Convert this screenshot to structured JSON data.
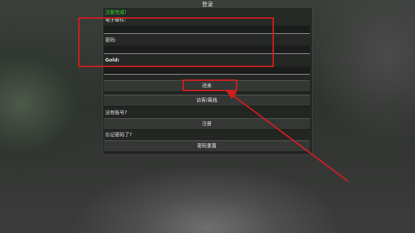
{
  "header": {
    "title": "登录"
  },
  "form": {
    "success_message": "注册完成!",
    "email_label": "电子邮件:",
    "email_value": "",
    "password_label": "密码:",
    "password_value": "",
    "gold_label": "Gold:",
    "gold_value": ""
  },
  "buttons": {
    "enter": "进来",
    "guest_offline": "访客/离线",
    "no_account_label": "没有账号?",
    "register": "注册",
    "forgot_label": "忘记密码了?",
    "reset_password": "密码重置"
  },
  "colors": {
    "success": "#2ee02e",
    "annotation": "#d11f1f"
  }
}
